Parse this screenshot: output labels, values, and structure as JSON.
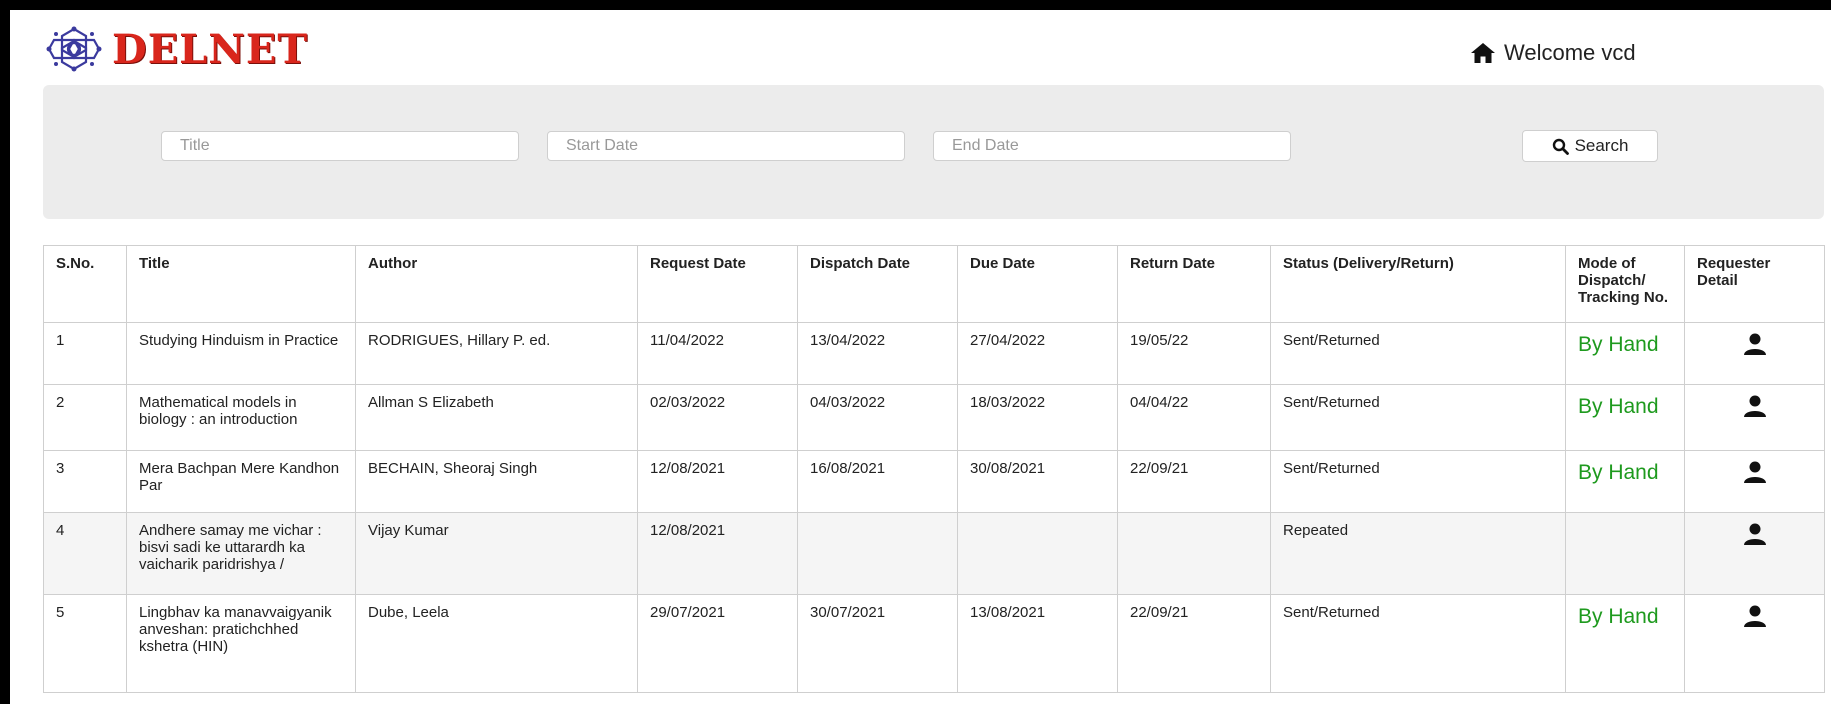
{
  "header": {
    "logo_text": "DELNET",
    "welcome": "Welcome vcd"
  },
  "search": {
    "title_placeholder": "Title",
    "start_placeholder": "Start Date",
    "end_placeholder": "End Date",
    "button_label": "Search"
  },
  "table": {
    "columns": [
      "S.No.",
      "Title",
      "Author",
      "Request Date",
      "Dispatch Date",
      "Due Date",
      "Return Date",
      "Status (Delivery/Return)",
      "Mode of Dispatch/ Tracking No.",
      "Requester Detail"
    ],
    "rows": [
      {
        "sno": "1",
        "title": "Studying Hinduism in Practice",
        "author": "RODRIGUES, Hillary P. ed.",
        "request": "11/04/2022",
        "dispatch": "13/04/2022",
        "due": "27/04/2022",
        "return": "19/05/22",
        "status": "Sent/Returned",
        "mode": "By Hand"
      },
      {
        "sno": "2",
        "title": "Mathematical models in biology : an introduction",
        "author": "Allman S Elizabeth",
        "request": "02/03/2022",
        "dispatch": "04/03/2022",
        "due": "18/03/2022",
        "return": "04/04/22",
        "status": "Sent/Returned",
        "mode": "By Hand"
      },
      {
        "sno": "3",
        "title": "Mera Bachpan Mere Kandhon Par",
        "author": "BECHAIN, Sheoraj Singh",
        "request": "12/08/2021",
        "dispatch": "16/08/2021",
        "due": "30/08/2021",
        "return": "22/09/21",
        "status": "Sent/Returned",
        "mode": "By Hand"
      },
      {
        "sno": "4",
        "title": "Andhere samay me vichar : bisvi sadi ke uttarardh ka vaicharik paridrishya /",
        "author": "Vijay Kumar",
        "request": "12/08/2021",
        "dispatch": "",
        "due": "",
        "return": "",
        "status": "Repeated",
        "mode": ""
      },
      {
        "sno": "5",
        "title": "Lingbhav ka manavvaigyanik anveshan: pratichchhed kshetra (HIN)",
        "author": "Dube, Leela",
        "request": "29/07/2021",
        "dispatch": "30/07/2021",
        "due": "13/08/2021",
        "return": "22/09/21",
        "status": "Sent/Returned",
        "mode": "By Hand"
      }
    ]
  },
  "colors": {
    "brand": "#d9261c",
    "logo_emblem": "#3b3a9e",
    "mode_text": "#1e9a1e",
    "panel_bg": "#ececec"
  },
  "icons": {
    "home": "home-icon",
    "search": "search-icon",
    "requester": "user-icon"
  }
}
